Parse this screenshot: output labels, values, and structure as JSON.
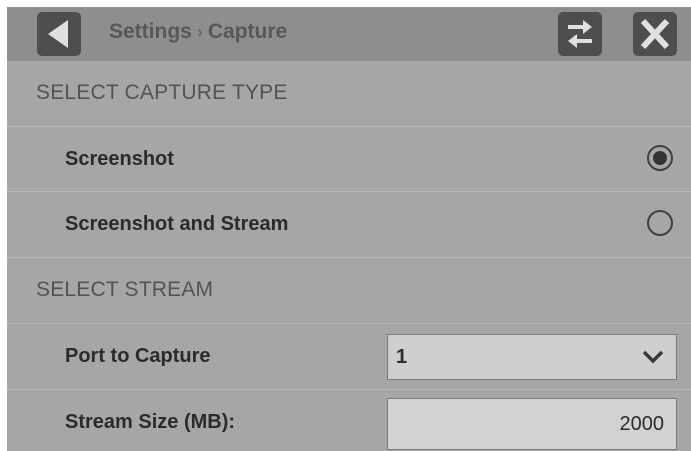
{
  "header": {
    "breadcrumb_parent": "Settings",
    "breadcrumb_separator": "›",
    "breadcrumb_current": "Capture",
    "back_icon": "back-triangle-icon",
    "swap_icon": "swap-arrows-icon",
    "close_icon": "close-x-icon"
  },
  "capture_type": {
    "section_title": "SELECT CAPTURE TYPE",
    "options": [
      {
        "label": "Screenshot",
        "selected": true
      },
      {
        "label": "Screenshot and Stream",
        "selected": false
      }
    ]
  },
  "stream": {
    "section_title": "SELECT STREAM",
    "port_label": "Port to Capture",
    "port_value": "1",
    "size_label": "Stream Size (MB):",
    "size_value": "2000"
  },
  "colors": {
    "panel": "#a6a6a6",
    "header": "#8e8e8e",
    "button": "#4e4e4e"
  }
}
